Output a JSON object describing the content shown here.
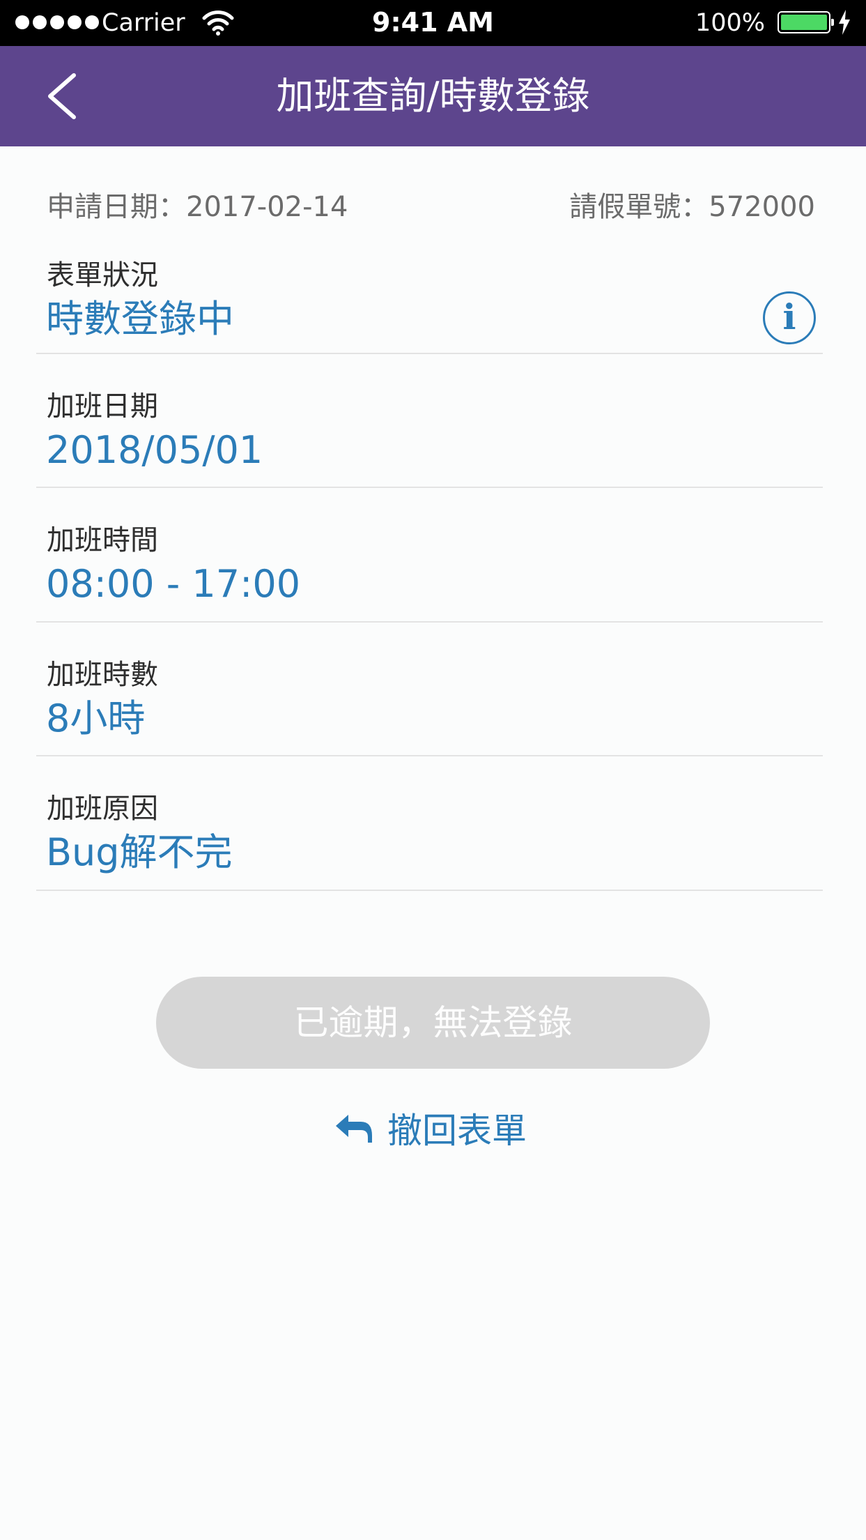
{
  "status_bar": {
    "carrier": "Carrier",
    "time": "9:41 AM",
    "battery": "100%",
    "battery_level": 1.0
  },
  "nav": {
    "title": "加班查詢/時數登錄",
    "back_icon": "chevron-left-icon"
  },
  "meta": {
    "apply_date": "申請日期：2017-02-14",
    "form_number": "請假單號：572000"
  },
  "fields": [
    {
      "label": "表單狀況",
      "value": "時數登錄中"
    },
    {
      "label": "加班日期",
      "value": "2018/05/01"
    },
    {
      "label": "加班時間",
      "value": "08:00 - 17:00"
    },
    {
      "label": "加班時數",
      "value": "8小時"
    },
    {
      "label": "加班原因",
      "value": "Bug解不完"
    }
  ],
  "info_icon": "i",
  "actions": {
    "expired_label": "已逾期，無法登錄",
    "withdraw_label": "撤回表單",
    "withdraw_icon": "reply-arrow-icon"
  },
  "colors": {
    "nav_bg": "#5d458d",
    "accent": "#2b7cb8",
    "disabled_button": "#d6d6d6",
    "battery_green": "#4cd964"
  }
}
